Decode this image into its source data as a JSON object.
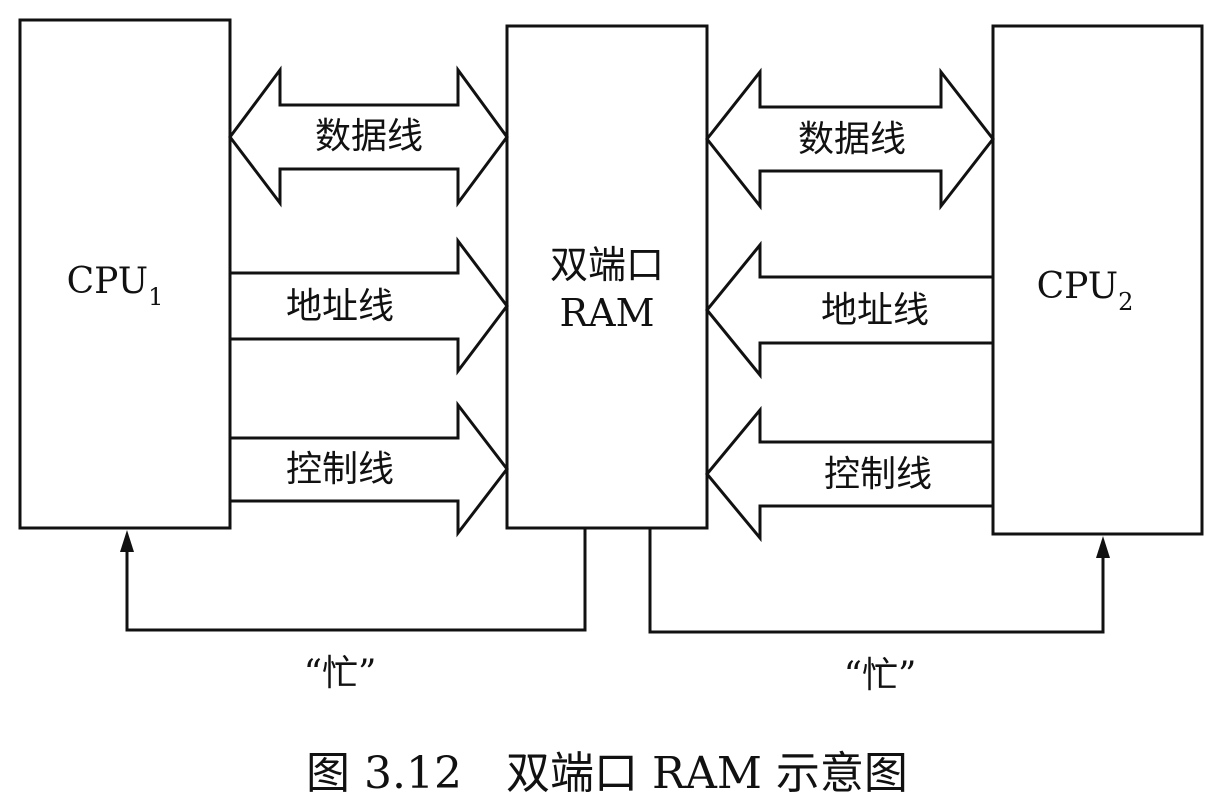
{
  "cpu1": {
    "name": "CPU",
    "sub": "1"
  },
  "cpu2": {
    "name": "CPU",
    "sub": "2"
  },
  "ram": {
    "line1": "双端口",
    "line2": "RAM"
  },
  "left_bus": {
    "data": "数据线",
    "address": "地址线",
    "control": "控制线"
  },
  "right_bus": {
    "data": "数据线",
    "address": "地址线",
    "control": "控制线"
  },
  "busy_left": "“忙”",
  "busy_right": "“忙”",
  "caption": "图 3.12　双端口 RAM 示意图"
}
